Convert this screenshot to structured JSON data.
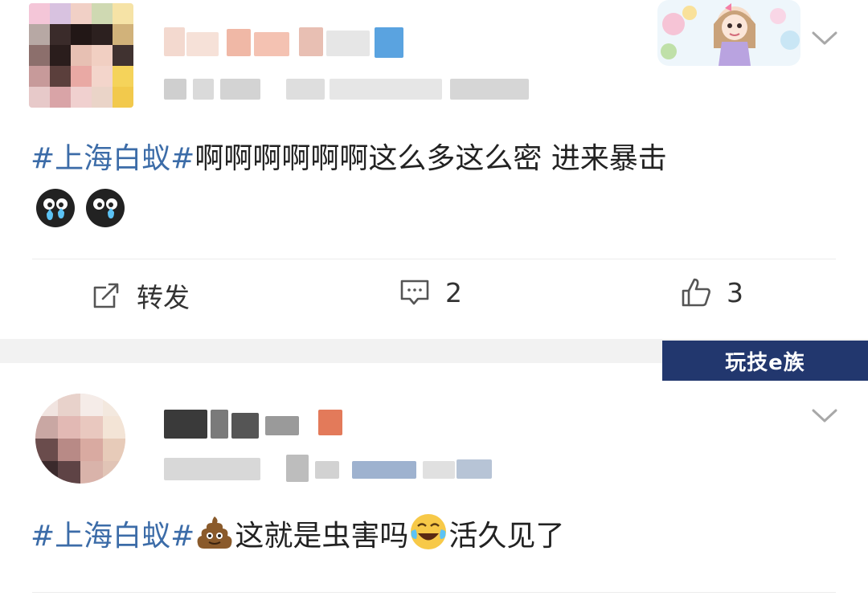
{
  "posts": [
    {
      "hashtag": "#上海白蚁#",
      "text": "啊啊啊啊啊啊这么多这么密 进来暴击",
      "emojis": [
        "crying-face-emoji",
        "crying-face-emoji"
      ],
      "actions": {
        "repost_label": "转发",
        "comment_count": "2",
        "like_count": "3"
      }
    },
    {
      "hashtag": "#上海白蚁#",
      "text_after_poop": "这就是虫害吗",
      "text_after_laugh": "活久见了",
      "emojis": [
        "poop-emoji",
        "laughing-tears-emoji"
      ]
    }
  ],
  "watermark": "玩技e族",
  "colors": {
    "hashtag": "#3c6ca8",
    "separator": "#f2f2f2",
    "watermark_bg": "#22376e"
  }
}
